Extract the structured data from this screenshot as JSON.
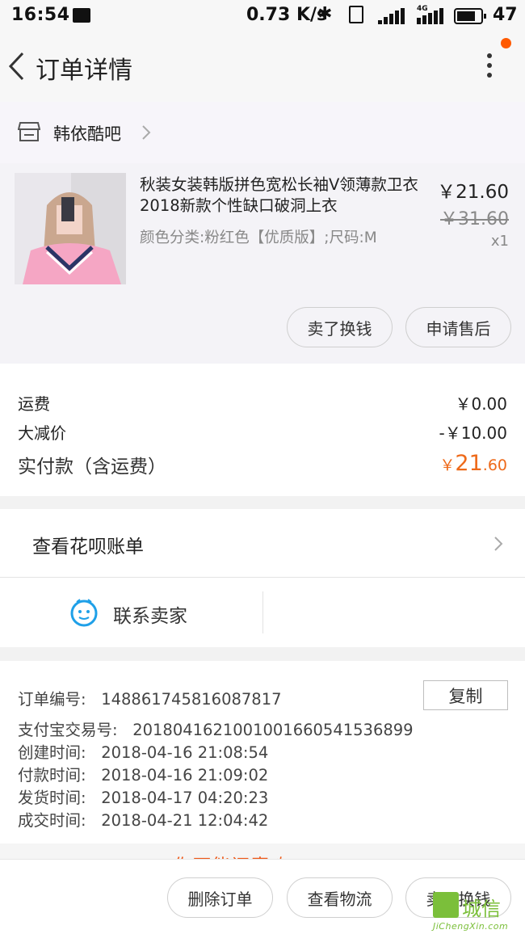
{
  "status_bar": {
    "time": "16:54",
    "network_speed": "0.73 K/s",
    "network_type": "4G",
    "battery_percent": "47"
  },
  "header": {
    "title": "订单详情",
    "notification_dot_color": "#ff5a00"
  },
  "shop": {
    "name": "韩依酷吧"
  },
  "item": {
    "title": "秋装女装韩版拼色宽松长袖V领薄款卫衣2018新款个性缺口破洞上衣",
    "spec": "颜色分类:粉红色【优质版】;尺码:M",
    "price": "￥21.60",
    "original_price": "￥31.60",
    "quantity": "x1",
    "actions": [
      "卖了换钱",
      "申请售后"
    ]
  },
  "fees": {
    "shipping_label": "运费",
    "shipping_value": "￥0.00",
    "discount_label": "大减价",
    "discount_value": "-￥10.00",
    "paid_label": "实付款（含运费）",
    "paid_currency": "￥",
    "paid_int": "21",
    "paid_dec": ".60",
    "accent_color": "#ee6a1a"
  },
  "huabei": {
    "label": "查看花呗账单"
  },
  "contact": {
    "label": "联系卖家"
  },
  "order_info": {
    "order_no_label": "订单编号:",
    "order_no": "148861745816087817",
    "copy_label": "复制",
    "alipay_no_label": "支付宝交易号:",
    "alipay_no": "2018041621001001660541536899",
    "created_label": "创建时间:",
    "created": "2018-04-16 21:08:54",
    "paid_label": "付款时间:",
    "paid": "2018-04-16 21:09:02",
    "shipped_label": "发货时间:",
    "shipped": "2018-04-17 04:20:23",
    "completed_label": "成交时间:",
    "completed": "2018-04-21 12:04:42"
  },
  "peek_text": "你可能还喜欢",
  "bottom_actions": [
    "删除订单",
    "查看物流",
    "卖了换钱"
  ],
  "watermark": {
    "text": "城信",
    "sub": "JiChengXin.com"
  }
}
